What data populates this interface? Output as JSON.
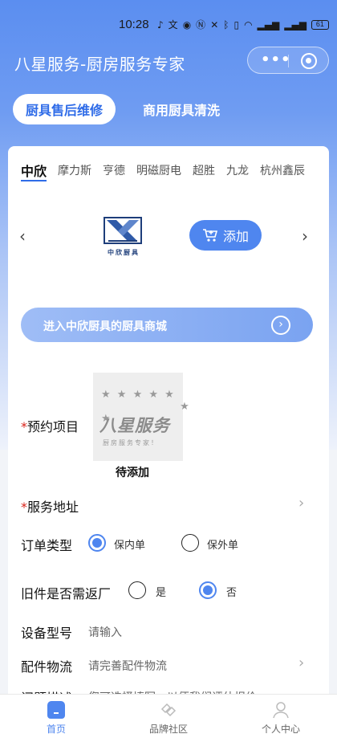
{
  "status_bar": {
    "time": "10:28",
    "icons": [
      "ringtone-icon",
      "translate-icon",
      "eye-icon",
      "nfc-icon",
      "mute-icon",
      "bluetooth-icon",
      "vibrate-icon",
      "wifi-icon",
      "signal-icon",
      "signal-icon"
    ],
    "battery": "61"
  },
  "navbar": {
    "title": "八星服务-厨房服务专家",
    "more_label": "•••"
  },
  "top_tabs": [
    {
      "label": "厨具售后维修",
      "active": true
    },
    {
      "label": "商用厨具清洗",
      "active": false
    }
  ],
  "brand_tabs": [
    {
      "label": "中欣",
      "active": true
    },
    {
      "label": "摩力斯",
      "active": false
    },
    {
      "label": "亨德",
      "active": false
    },
    {
      "label": "明磁厨电",
      "active": false
    },
    {
      "label": "超胜",
      "active": false
    },
    {
      "label": "九龙",
      "active": false
    },
    {
      "label": "杭州鑫辰",
      "active": false
    }
  ],
  "brand": {
    "logo_caption": "中欣厨具",
    "add_label": "添加",
    "prev_arrow": "‹",
    "next_arrow": "›"
  },
  "mall_banner": {
    "label": "进入中欣厨具的厨具商城",
    "go_glyph": "›"
  },
  "form": {
    "required_mark": "*",
    "project_label": "预约项目",
    "placeholder_logo_big": "八星服务",
    "placeholder_logo_small": "厨房服务专家！",
    "pending_label": "待添加",
    "address_label": "服务地址",
    "order_type_label": "订单类型",
    "order_type_options": [
      {
        "label": "保内单",
        "selected": true
      },
      {
        "label": "保外单",
        "selected": false
      }
    ],
    "return_label": "旧件是否需返厂",
    "return_options": [
      {
        "label": "是",
        "selected": false
      },
      {
        "label": "否",
        "selected": true
      }
    ],
    "model_label": "设备型号",
    "model_placeholder": "请输入",
    "logistics_label": "配件物流",
    "logistics_placeholder": "请完善配件物流",
    "problem_label": "问题描述",
    "problem_placeholder": "您可选择填写，以便我们评估报价"
  },
  "tabbar": [
    {
      "label": "首页",
      "active": true,
      "icon": "home-icon"
    },
    {
      "label": "品牌社区",
      "active": false,
      "icon": "community-icon"
    },
    {
      "label": "个人中心",
      "active": false,
      "icon": "user-icon"
    }
  ],
  "colors": {
    "accent": "#4f86ef",
    "header": "#5b8ef0",
    "required": "#d8231a"
  }
}
